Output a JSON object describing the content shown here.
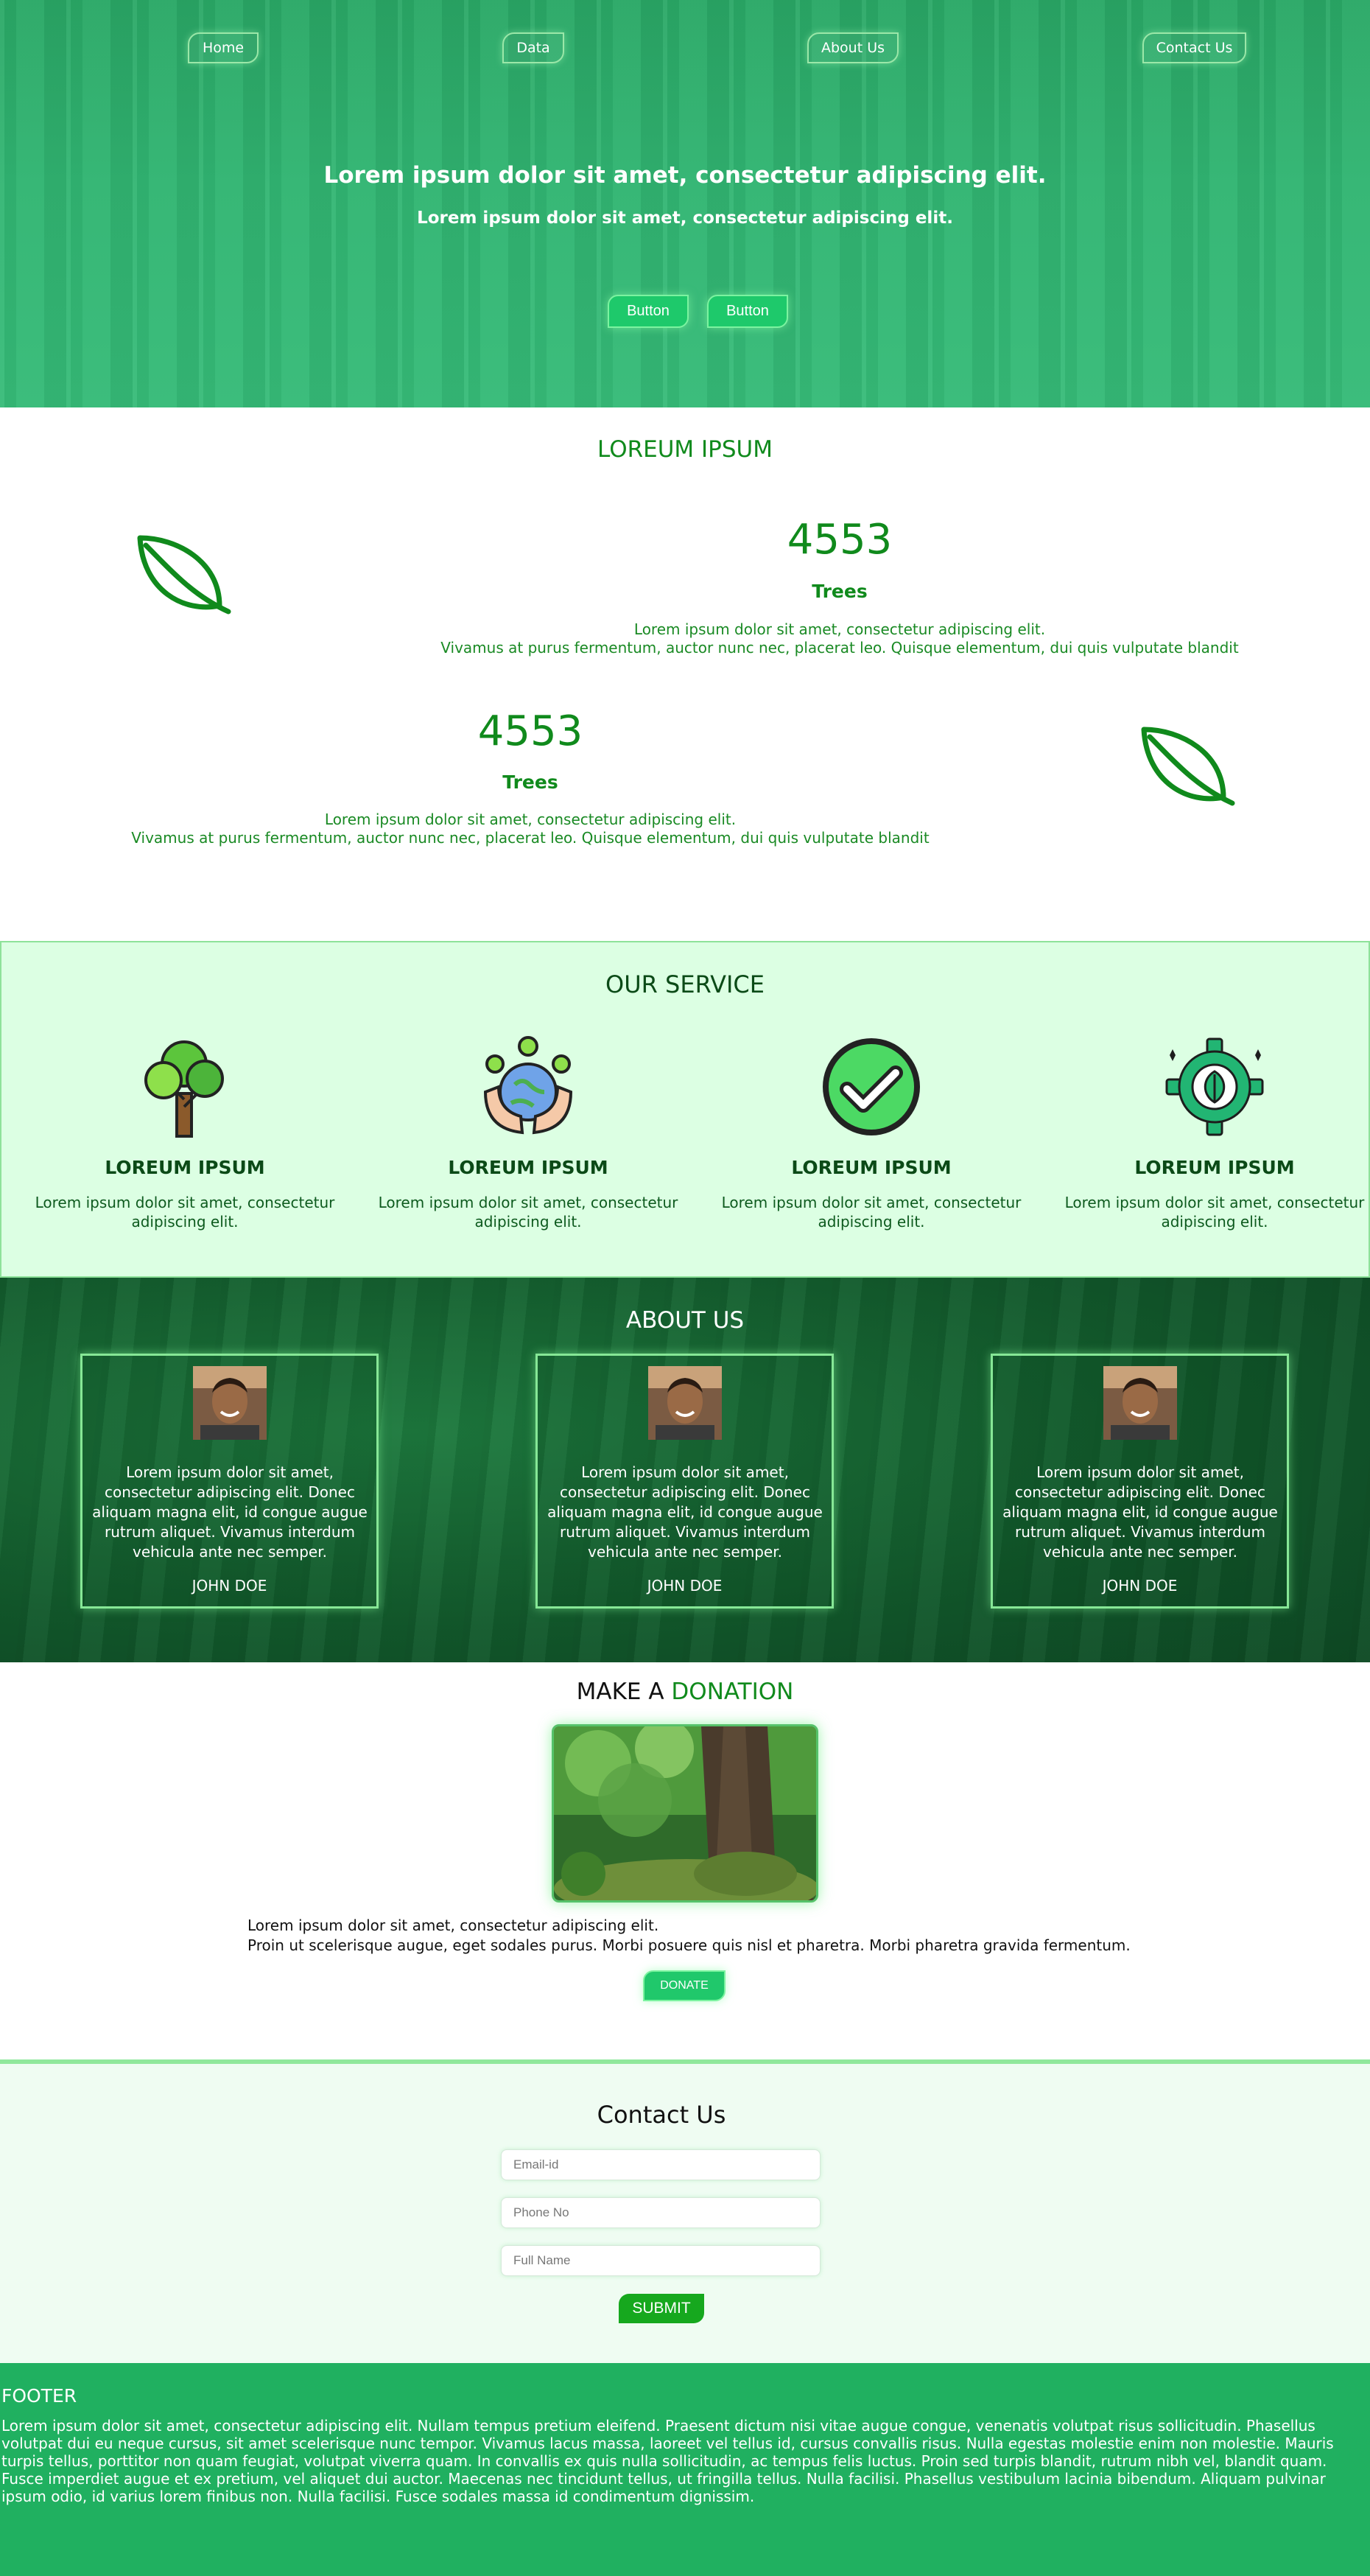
{
  "nav": {
    "items": [
      {
        "label": "Home"
      },
      {
        "label": "Data"
      },
      {
        "label": "About Us"
      },
      {
        "label": "Contact Us"
      }
    ]
  },
  "hero": {
    "title": "Lorem ipsum dolor sit amet, consectetur adipiscing elit.",
    "subtitle": "Lorem ipsum dolor sit amet, consectetur adipiscing elit.",
    "buttons": [
      "Button",
      "Button"
    ]
  },
  "stats": {
    "title": "LOREUM IPSUM",
    "items": [
      {
        "value": "4553",
        "label": "Trees",
        "text_line1": "Lorem ipsum dolor sit amet, consectetur adipiscing elit.",
        "text_line2": "Vivamus at purus fermentum, auctor nunc nec, placerat leo. Quisque elementum, dui quis vulputate blandit"
      },
      {
        "value": "4553",
        "label": "Trees",
        "text_line1": "Lorem ipsum dolor sit amet, consectetur adipiscing elit.",
        "text_line2": "Vivamus at purus fermentum, auctor nunc nec, placerat leo. Quisque elementum, dui quis vulputate blandit"
      }
    ],
    "icon": "leaf-icon",
    "color": "#108a1c"
  },
  "service": {
    "title": "OUR SERVICE",
    "items": [
      {
        "icon": "tree-icon",
        "name": "LOREUM IPSUM",
        "desc": "Lorem ipsum dolor sit amet, consectetur adipiscing elit."
      },
      {
        "icon": "globe-hands-icon",
        "name": "LOREUM IPSUM",
        "desc": "Lorem ipsum dolor sit amet, consectetur adipiscing elit."
      },
      {
        "icon": "check-circle-icon",
        "name": "LOREUM IPSUM",
        "desc": "Lorem ipsum dolor sit amet, consectetur adipiscing elit."
      },
      {
        "icon": "gear-leaf-icon",
        "name": "LOREUM IPSUM",
        "desc": "Lorem ipsum dolor sit amet, consectetur adipiscing elit."
      }
    ]
  },
  "about": {
    "title": "ABOUT US",
    "cards": [
      {
        "text": "Lorem ipsum dolor sit amet, consectetur adipiscing elit. Donec aliquam magna elit, id congue augue rutrum aliquet. Vivamus interdum vehicula ante nec semper.",
        "name": "JOHN DOE"
      },
      {
        "text": "Lorem ipsum dolor sit amet, consectetur adipiscing elit. Donec aliquam magna elit, id congue augue rutrum aliquet. Vivamus interdum vehicula ante nec semper.",
        "name": "JOHN DOE"
      },
      {
        "text": "Lorem ipsum dolor sit amet, consectetur adipiscing elit. Donec aliquam magna elit, id congue augue rutrum aliquet. Vivamus interdum vehicula ante nec semper.",
        "name": "JOHN DOE"
      }
    ]
  },
  "donation": {
    "title_prefix": "MAKE A ",
    "title_accent": "DONATION",
    "text_line1": "Lorem ipsum dolor sit amet, consectetur adipiscing elit.",
    "text_line2": "Proin ut scelerisque augue, eget sodales purus. Morbi posuere quis nisl et pharetra. Morbi pharetra gravida fermentum.",
    "button": "DONATE"
  },
  "contact": {
    "title": "Contact Us",
    "fields": [
      {
        "placeholder": "Email-id"
      },
      {
        "placeholder": "Phone No"
      },
      {
        "placeholder": "Full Name"
      }
    ],
    "submit": "SUBMIT"
  },
  "footer": {
    "title": "FOOTER",
    "text": "Lorem ipsum dolor sit amet, consectetur adipiscing elit. Nullam tempus pretium eleifend. Praesent dictum nisi vitae augue congue, venenatis volutpat risus sollicitudin. Phasellus volutpat dui eu neque cursus, sit amet scelerisque nunc tempor. Vivamus lacus massa, laoreet vel tellus id, cursus convallis risus. Nulla egestas molestie enim non molestie. Mauris turpis tellus, porttitor non quam feugiat, volutpat viverra quam. In convallis ex quis nulla sollicitudin, ac tempus felis luctus. Proin sed turpis blandit, rutrum nibh vel, blandit quam. Fusce imperdiet augue et ex pretium, vel aliquet dui auctor. Maecenas nec tincidunt tellus, ut fringilla tellus. Nulla facilisi. Phasellus vestibulum lacinia bibendum. Aliquam pulvinar ipsum odio, id varius lorem finibus non. Nulla facilisi. Fusce sodales massa id condimentum dignissim."
  },
  "colors": {
    "brand_green": "#20b060",
    "accent_green": "#108a1c",
    "service_bg": "#dcffe3",
    "contact_bg": "#effcf2"
  }
}
